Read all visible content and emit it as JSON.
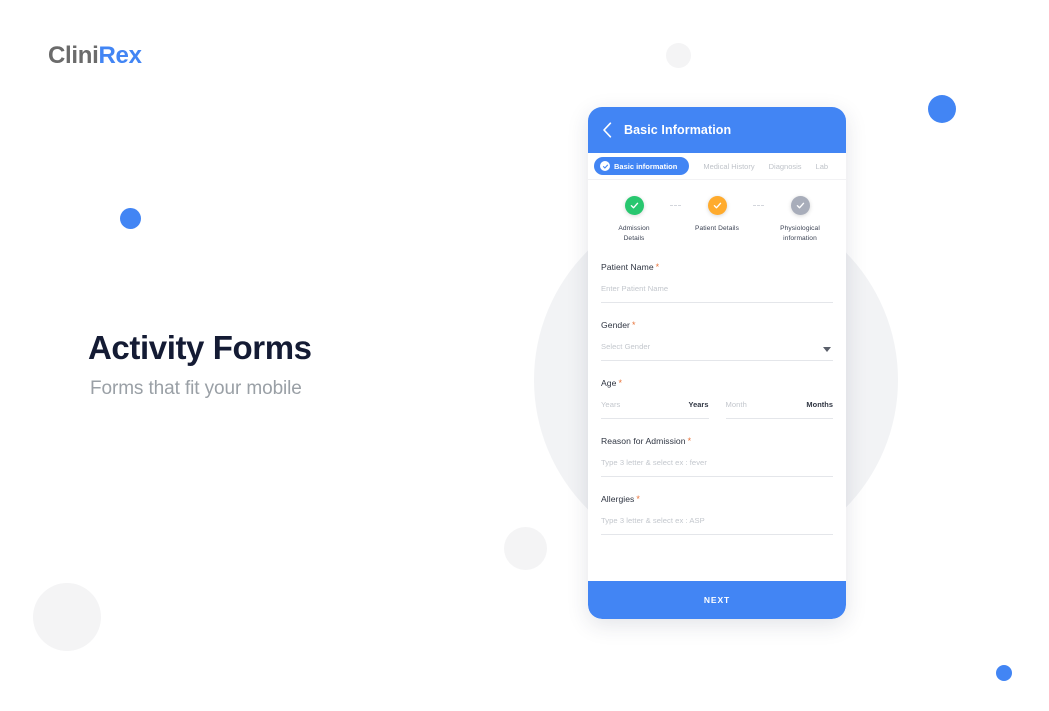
{
  "brand": {
    "part1": "Clini",
    "part2": "Rex",
    "accent_color": "#4285f4"
  },
  "hero": {
    "title": "Activity Forms",
    "subtitle": "Forms that fit your mobile"
  },
  "phone": {
    "header": {
      "back_icon": "chevron-left-icon",
      "title": "Basic Information",
      "background_color": "#4285f4"
    },
    "tabs": [
      {
        "label": "Basic information",
        "active": true,
        "icon": "check-circle-icon"
      },
      {
        "label": "Medical History",
        "active": false
      },
      {
        "label": "Diagnosis",
        "active": false
      },
      {
        "label": "Lab",
        "active": false
      }
    ],
    "stepper": [
      {
        "label": "Admission\nDetails",
        "label_line1": "Admission",
        "label_line2": "Details",
        "state": "complete",
        "color": "#28c76f",
        "icon": "check-icon"
      },
      {
        "label": "Patient Details",
        "label_line1": "Patient Details",
        "label_line2": "",
        "state": "current",
        "color": "#ffab2d",
        "icon": "check-icon"
      },
      {
        "label": "Physiological information",
        "label_line1": "Physiological",
        "label_line2": "information",
        "state": "pending",
        "color": "#a8adba",
        "icon": "check-icon"
      }
    ],
    "fields": [
      {
        "label": "Patient Name",
        "required_marker": "*",
        "placeholder": "Enter Patient Name",
        "value": "",
        "type": "text"
      },
      {
        "label": "Gender",
        "required_marker": "*",
        "placeholder": "Select Gender",
        "value": "",
        "type": "select",
        "icon": "caret-down-icon"
      },
      {
        "label": "Age",
        "required_marker": "*",
        "type": "age",
        "years": {
          "placeholder": "Years",
          "value": "",
          "unit": "Years"
        },
        "months": {
          "placeholder": "Month",
          "value": "",
          "unit": "Months"
        }
      },
      {
        "label": "Reason for Admission",
        "required_marker": "*",
        "placeholder": "Type 3 letter & select ex : fever",
        "value": "",
        "type": "autocomplete"
      },
      {
        "label": "Allergies",
        "required_marker": "*",
        "placeholder": "Type 3 letter & select ex : ASP",
        "value": "",
        "type": "autocomplete"
      }
    ],
    "next_button": "NEXT"
  },
  "decorations": {
    "blue": "#4285f4",
    "gray": "#f4f4f5",
    "big_circle": "#f2f3f5"
  }
}
